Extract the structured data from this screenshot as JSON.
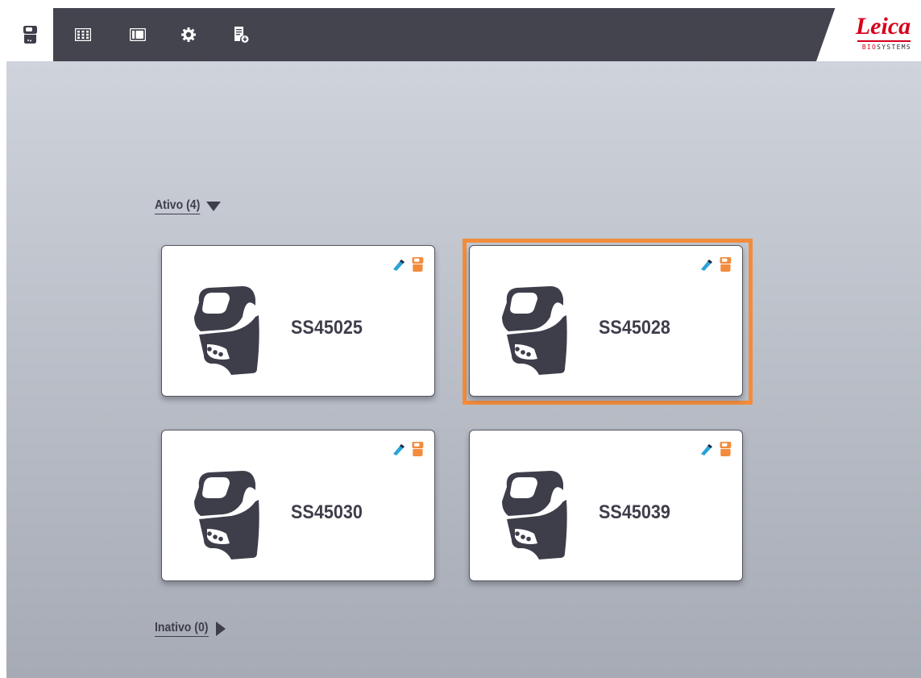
{
  "nav": {
    "items": [
      {
        "name": "instrument-icon"
      },
      {
        "name": "grid-icon"
      },
      {
        "name": "slide-icon"
      },
      {
        "name": "gear-icon"
      },
      {
        "name": "report-download-icon"
      }
    ]
  },
  "brand": {
    "logo_text": "Leica",
    "sub_bio": "BIO",
    "sub_systems": "SYSTEMS"
  },
  "sections": {
    "active": {
      "label": "Ativo (4)",
      "expanded": true
    },
    "inactive": {
      "label": "Inativo (0)",
      "expanded": false
    }
  },
  "instruments": [
    {
      "name": "SS45025",
      "selected": false
    },
    {
      "name": "SS45028",
      "selected": true
    },
    {
      "name": "SS45030",
      "selected": false
    },
    {
      "name": "SS45039",
      "selected": false
    }
  ],
  "colors": {
    "topbar": "#44444f",
    "accent_orange": "#f28c3c",
    "tag_blue": "#2aa3d8",
    "brand_red": "#d6001c",
    "dark_text": "#3e3e4b"
  }
}
